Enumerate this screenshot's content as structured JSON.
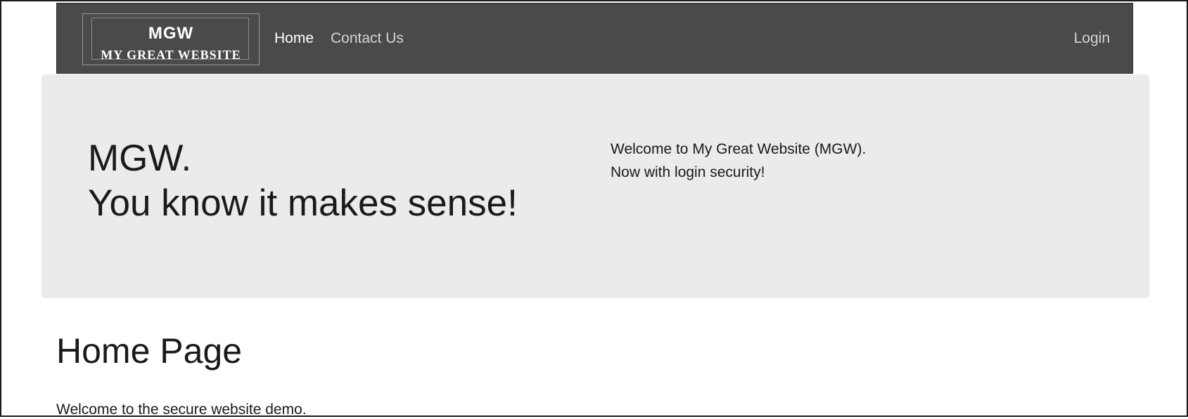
{
  "navbar": {
    "brand": {
      "top_text": "MGW",
      "bottom_text": "MY GREAT WEBSITE"
    },
    "links": [
      {
        "label": "Home"
      },
      {
        "label": "Contact Us"
      }
    ],
    "login_label": "Login",
    "colors": {
      "background": "#4a4a4a",
      "active_link": "#ffffff",
      "inactive_link": "#d3d3d3"
    }
  },
  "hero": {
    "title_lines": [
      "MGW.",
      "You know it makes sense!"
    ],
    "text_lines": [
      "Welcome to My Great Website (MGW).",
      "Now with login security!"
    ],
    "background": "#ebebeb"
  },
  "main": {
    "title": "Home Page",
    "text": "Welcome to the secure website demo."
  }
}
